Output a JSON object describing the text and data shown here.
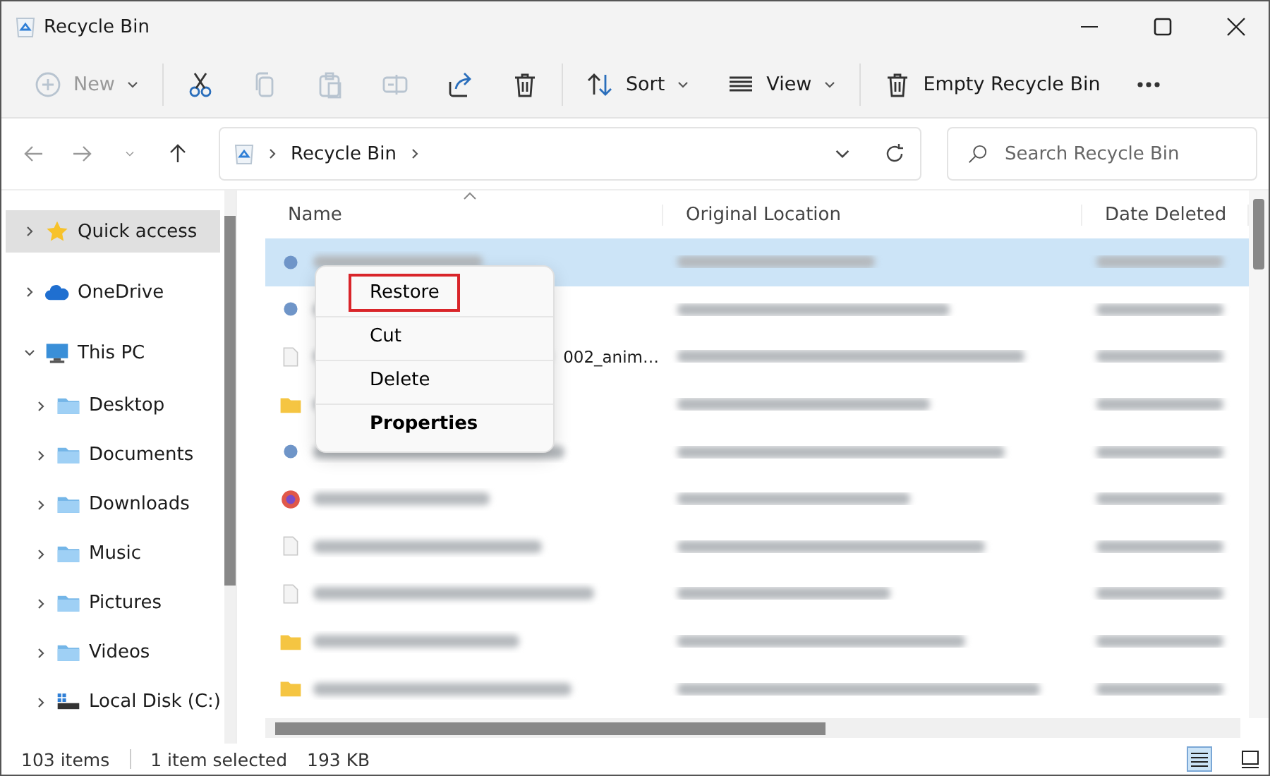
{
  "window": {
    "title": "Recycle Bin"
  },
  "toolbar": {
    "items": [
      {
        "kind": "new",
        "label": "New",
        "disabled": true
      },
      {
        "kind": "cut",
        "disabled": false
      },
      {
        "kind": "copy",
        "disabled": true
      },
      {
        "kind": "paste",
        "disabled": true
      },
      {
        "kind": "rename",
        "disabled": true
      },
      {
        "kind": "share",
        "disabled": false
      },
      {
        "kind": "delete",
        "disabled": false
      },
      {
        "kind": "sort",
        "label": "Sort",
        "disabled": false
      },
      {
        "kind": "view",
        "label": "View",
        "disabled": false
      },
      {
        "kind": "empty",
        "label": "Empty Recycle Bin",
        "disabled": false
      },
      {
        "kind": "more",
        "disabled": false
      }
    ]
  },
  "address": {
    "path": "Recycle Bin",
    "search_placeholder": "Search Recycle Bin"
  },
  "sidebar": {
    "items": [
      {
        "label": "Quick access",
        "kind": "star",
        "selected": true,
        "expanded": false
      },
      {
        "label": "OneDrive",
        "kind": "cloud",
        "selected": false,
        "expanded": false
      },
      {
        "label": "This PC",
        "kind": "pc",
        "selected": false,
        "expanded": true,
        "children": [
          {
            "label": "Desktop",
            "kind": "folder",
            "selected": false,
            "expanded": false
          },
          {
            "label": "Documents",
            "kind": "folder",
            "selected": false,
            "expanded": false
          },
          {
            "label": "Downloads",
            "kind": "folder",
            "selected": false,
            "expanded": false
          },
          {
            "label": "Music",
            "kind": "folder",
            "selected": false,
            "expanded": false
          },
          {
            "label": "Pictures",
            "kind": "folder",
            "selected": false,
            "expanded": false
          },
          {
            "label": "Videos",
            "kind": "folder",
            "selected": false,
            "expanded": false
          },
          {
            "label": "Local Disk (C:)",
            "kind": "disk",
            "selected": false,
            "expanded": false
          }
        ]
      }
    ]
  },
  "table": {
    "columns": [
      "Name",
      "Original Location",
      "Date Deleted"
    ],
    "rows": [
      {
        "kind": "image",
        "selected": true
      },
      {
        "kind": "image",
        "selected": false
      },
      {
        "kind": "file",
        "selected": false,
        "name": "002_anim…"
      },
      {
        "kind": "folder",
        "selected": false
      },
      {
        "kind": "image",
        "selected": false
      },
      {
        "kind": "app",
        "selected": false
      },
      {
        "kind": "file",
        "selected": false
      },
      {
        "kind": "file",
        "selected": false
      },
      {
        "kind": "folder",
        "selected": false
      },
      {
        "kind": "folder",
        "selected": false
      }
    ]
  },
  "context_menu": {
    "items": [
      {
        "label": "Restore",
        "highlighted": true,
        "default": false
      },
      {
        "label": "Cut",
        "highlighted": false,
        "default": false
      },
      {
        "label": "Delete",
        "highlighted": false,
        "default": false
      },
      {
        "label": "Properties",
        "highlighted": false,
        "default": true
      }
    ]
  },
  "status_bar": {
    "count": "103 items",
    "selection": "1 item selected",
    "size": "193 KB"
  }
}
